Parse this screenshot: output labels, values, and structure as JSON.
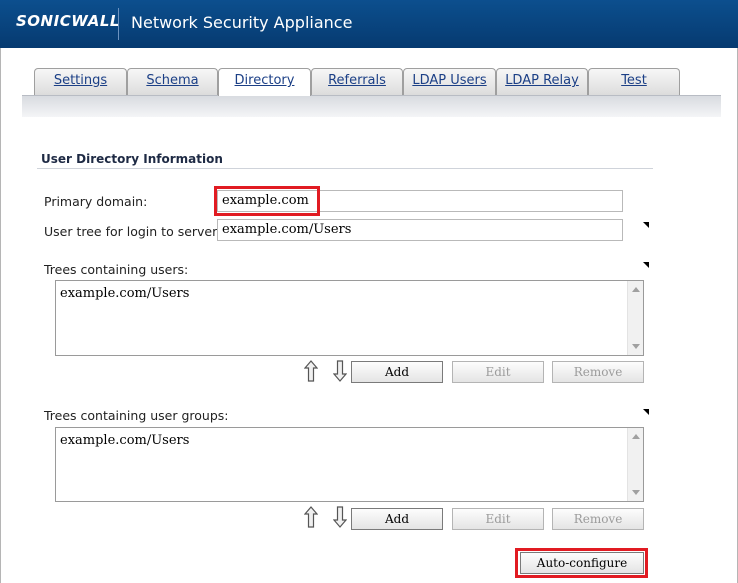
{
  "header": {
    "logo_text": "SONICWALL",
    "title": "Network Security Appliance"
  },
  "tabs": [
    {
      "label": "Settings",
      "active": false
    },
    {
      "label": "Schema",
      "active": false
    },
    {
      "label": "Directory",
      "active": true
    },
    {
      "label": "Referrals",
      "active": false
    },
    {
      "label": "LDAP Users",
      "active": false
    },
    {
      "label": "LDAP Relay",
      "active": false
    },
    {
      "label": "Test",
      "active": false
    }
  ],
  "section": {
    "title": "User Directory Information"
  },
  "form": {
    "primary_domain_label": "Primary domain:",
    "primary_domain_value": "example.com",
    "user_tree_label": "User tree for login to server:",
    "user_tree_value": "example.com/Users"
  },
  "user_trees": {
    "label": "Trees containing users:",
    "items": [
      "example.com/Users"
    ],
    "add_label": "Add",
    "edit_label": "Edit",
    "remove_label": "Remove"
  },
  "group_trees": {
    "label": "Trees containing user groups:",
    "items": [
      "example.com/Users"
    ],
    "add_label": "Add",
    "edit_label": "Edit",
    "remove_label": "Remove"
  },
  "actions": {
    "auto_configure_label": "Auto-configure"
  },
  "colors": {
    "header_bg": "#0a4a88",
    "highlight": "#e11b22",
    "tab_text": "#1b3f86"
  }
}
